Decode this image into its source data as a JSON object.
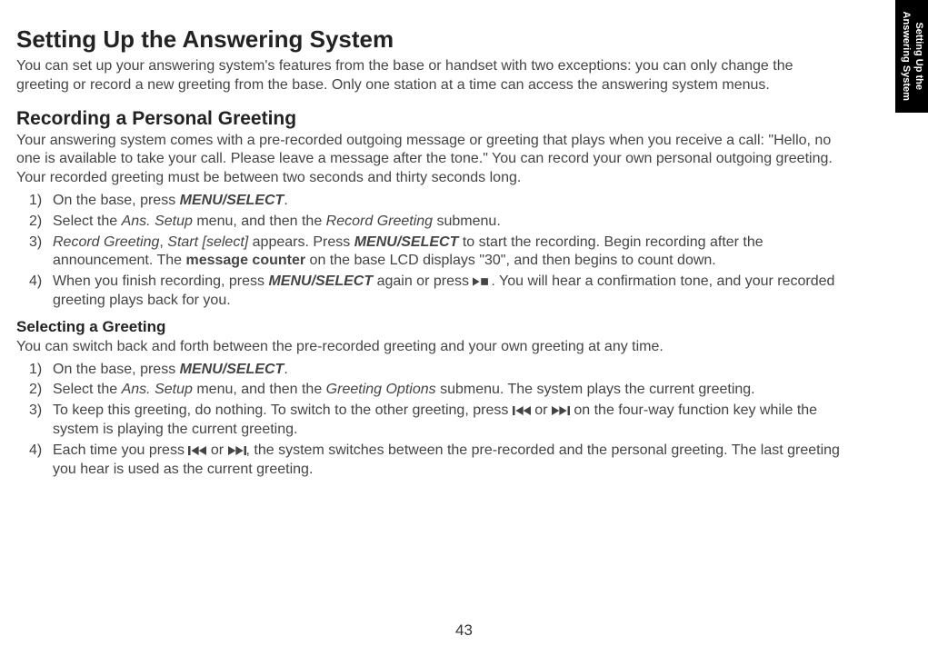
{
  "sideTab": {
    "line1": "Setting Up the",
    "line2": "Answering System"
  },
  "h1": "Setting Up the Answering System",
  "intro": "You can set up your answering system's features from the base or handset with two exceptions: you can only change the greeting or record a new greeting from the base. Only one station at a time can access the answering system menus.",
  "h2": "Recording a Personal Greeting",
  "greetIntro": "Your answering system comes with a pre-recorded outgoing message or greeting that plays when you receive a call: \"Hello, no one is available to take your call. Please leave a message after the tone.\" You can record your own personal outgoing greeting. Your recorded greeting must be between two seconds and thirty seconds long.",
  "rec": {
    "s1a": "On the base, press ",
    "s1b": "MENU/SELECT",
    "s1c": ".",
    "s2a": "Select the ",
    "s2b": "Ans. Setup",
    "s2c": " menu, and then the ",
    "s2d": "Record Greeting",
    "s2e": " submenu.",
    "s3a": "Record Greeting",
    "s3b": ", ",
    "s3c": "Start [select]",
    "s3d": " appears. Press ",
    "s3e": "MENU/SELECT",
    "s3f": " to start the recording. Begin recording after the announcement. The ",
    "s3g": "message counter",
    "s3h": " on the base LCD displays \"30\", and then begins to count down.",
    "s4a": "When you finish recording, press ",
    "s4b": "MENU/SELECT",
    "s4c": " again or press ",
    "s4d": ". You will hear a confirmation tone, and your recorded greeting plays back for you."
  },
  "h3": "Selecting a Greeting",
  "selIntro": "You can switch back and forth between the pre-recorded greeting and your own greeting at any time.",
  "sel": {
    "s1a": "On the base, press ",
    "s1b": "MENU/SELECT",
    "s1c": ".",
    "s2a": "Select the ",
    "s2b": "Ans. Setup",
    "s2c": " menu, and then the ",
    "s2d": "Greeting Options",
    "s2e": " submenu. The system plays the current greeting.",
    "s3a": "To keep this greeting, do nothing. To switch to the other greeting, press ",
    "s3b": " or ",
    "s3c": " on the four-way function key while the system is playing the current greeting.",
    "s4a": "Each time you press ",
    "s4b": " or ",
    "s4c": ", the system switches between the pre-recorded and the personal greeting. The last greeting you hear is used as the current greeting."
  },
  "pageNum": "43"
}
